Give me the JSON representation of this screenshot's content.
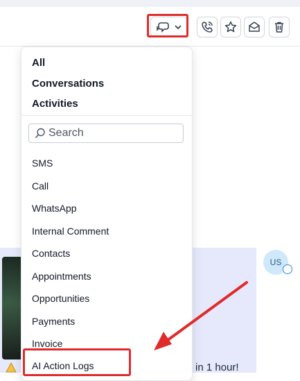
{
  "dropdown": {
    "groups": [
      "All",
      "Conversations",
      "Activities"
    ],
    "search_placeholder": "Search",
    "items": [
      "SMS",
      "Call",
      "WhatsApp",
      "Internal Comment",
      "Contacts",
      "Appointments",
      "Opportunities",
      "Payments",
      "Invoice",
      "AI Action Logs"
    ]
  },
  "conversation": {
    "avatar_initials": "US",
    "message_fragment": "in 1 hour!"
  },
  "icons": {
    "filter": "chat-filter-icon",
    "chevron": "chevron-down-icon",
    "call": "phone-icon",
    "star": "star-icon",
    "mail": "mail-open-icon",
    "trash": "trash-icon",
    "search": "search-icon",
    "warning": "warning-icon"
  },
  "colors": {
    "highlight": "#e02b2b",
    "message_bg": "#e5e9fb",
    "avatar_bg": "#cfe9fb"
  }
}
